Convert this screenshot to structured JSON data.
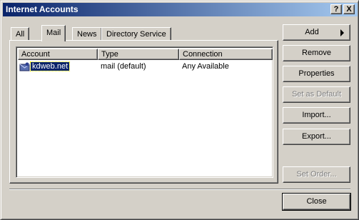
{
  "window": {
    "title": "Internet Accounts",
    "help_label": "?",
    "close_label": "X"
  },
  "tabs": [
    {
      "label": "All",
      "active": false
    },
    {
      "label": "Mail",
      "active": true
    },
    {
      "label": "News",
      "active": false
    },
    {
      "label": "Directory Service",
      "active": false
    }
  ],
  "list": {
    "columns": [
      "Account",
      "Type",
      "Connection"
    ],
    "rows": [
      {
        "account": "kdweb.net",
        "type": "mail (default)",
        "connection": "Any Available",
        "selected": true
      }
    ]
  },
  "buttons": {
    "add": "Add",
    "remove": "Remove",
    "properties": "Properties",
    "set_default": "Set as Default",
    "import": "Import...",
    "export": "Export...",
    "set_order": "Set Order...",
    "close": "Close"
  },
  "colors": {
    "titlebar_start": "#0a246a",
    "titlebar_end": "#a6caf0",
    "face": "#d4d0c8",
    "selection": "#0a246a"
  },
  "icons": {
    "account": "mail-account-icon"
  }
}
